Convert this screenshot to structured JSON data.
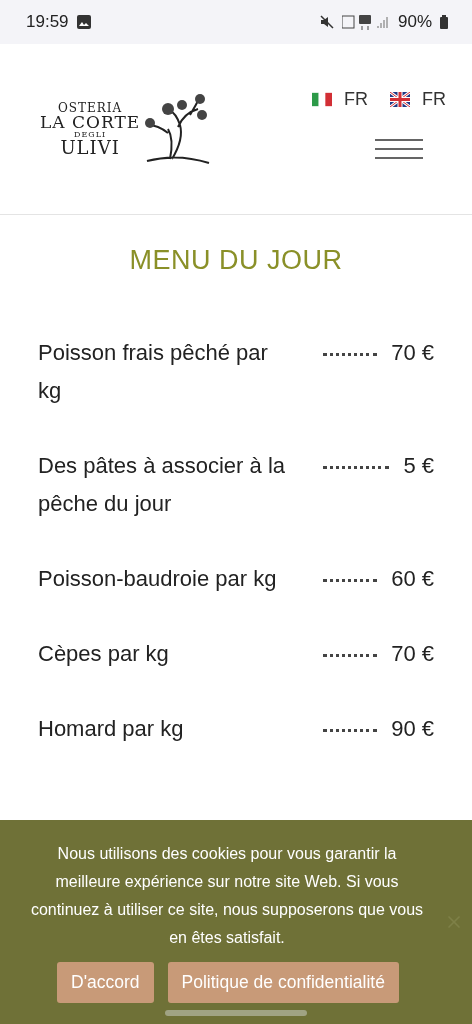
{
  "status_bar": {
    "time": "19:59",
    "battery": "90%"
  },
  "header": {
    "logo": {
      "line_1": "OSTERIA",
      "line_2": "LA CORTE",
      "line_3": "DEGLI",
      "line_4": "ULIVI"
    },
    "languages": [
      {
        "kind": "italy",
        "label": "FR"
      },
      {
        "kind": "uk",
        "label": "FR"
      }
    ]
  },
  "menu": {
    "title": "MENU DU JOUR",
    "items": [
      {
        "name": "Poisson frais pêché par kg",
        "price": "70 €"
      },
      {
        "name": "Des pâtes à associer à la pêche du jour",
        "price": "5 €"
      },
      {
        "name": "Poisson-baudroie par kg",
        "price": "60 €"
      },
      {
        "name": "Cèpes par kg",
        "price": "70 €"
      },
      {
        "name": "Homard par kg",
        "price": "90 €"
      }
    ]
  },
  "cookie_banner": {
    "text": "Nous utilisons des cookies pour vous garantir la meilleure expérience sur notre site Web. Si vous continuez à utiliser ce site, nous supposerons que vous en êtes satisfait.",
    "buttons": [
      "D'accord",
      "Politique de confidentialité"
    ]
  }
}
